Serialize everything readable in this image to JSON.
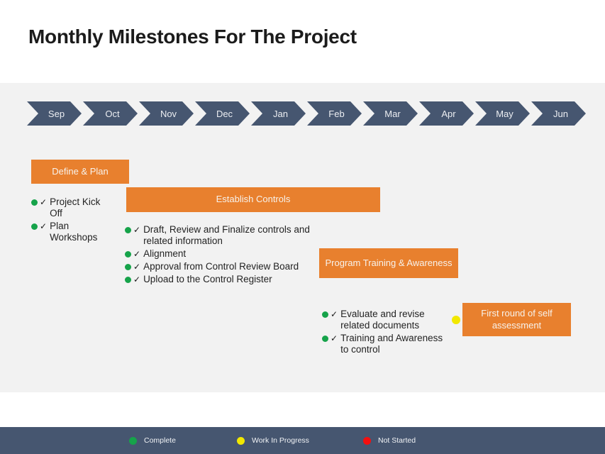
{
  "title": "Monthly Milestones For The Project",
  "colors": {
    "orange": "#e8802e",
    "slate": "#465670",
    "panel": "#f2f2f2",
    "complete": "#16a34a",
    "in_progress": "#f2e800",
    "not_started": "#f40f0f"
  },
  "timeline": {
    "months": [
      "Sep",
      "Oct",
      "Nov",
      "Dec",
      "Jan",
      "Feb",
      "Mar",
      "Apr",
      "May",
      "Jun"
    ]
  },
  "milestones": [
    {
      "id": "define",
      "label": "Define & Plan",
      "tasks": [
        {
          "status": "complete",
          "check": "✓",
          "text": "Project Kick Off"
        },
        {
          "status": "complete",
          "check": "✓",
          "text": "Plan Workshops"
        }
      ]
    },
    {
      "id": "controls",
      "label": "Establish Controls",
      "tasks": [
        {
          "status": "complete",
          "check": "✓",
          "text": "Draft, Review and Finalize controls and related information"
        },
        {
          "status": "complete",
          "check": "✓",
          "text": "Alignment"
        },
        {
          "status": "complete",
          "check": "✓",
          "text": "Approval from Control Review Board"
        },
        {
          "status": "complete",
          "check": "✓",
          "text": "Upload to the Control Register"
        }
      ]
    },
    {
      "id": "program",
      "label": "Program Training & Awareness",
      "tasks": [
        {
          "status": "complete",
          "check": "✓",
          "text": "Evaluate and revise related documents"
        },
        {
          "status": "complete",
          "check": "✓",
          "text": "Training and Awareness to control"
        }
      ]
    },
    {
      "id": "selfassess",
      "label": "First round of self assessment",
      "status": "in_progress",
      "tasks": []
    }
  ],
  "legend": [
    {
      "status": "complete",
      "label": "Complete"
    },
    {
      "status": "in_progress",
      "label": "Work In Progress"
    },
    {
      "status": "not_started",
      "label": "Not Started"
    }
  ]
}
